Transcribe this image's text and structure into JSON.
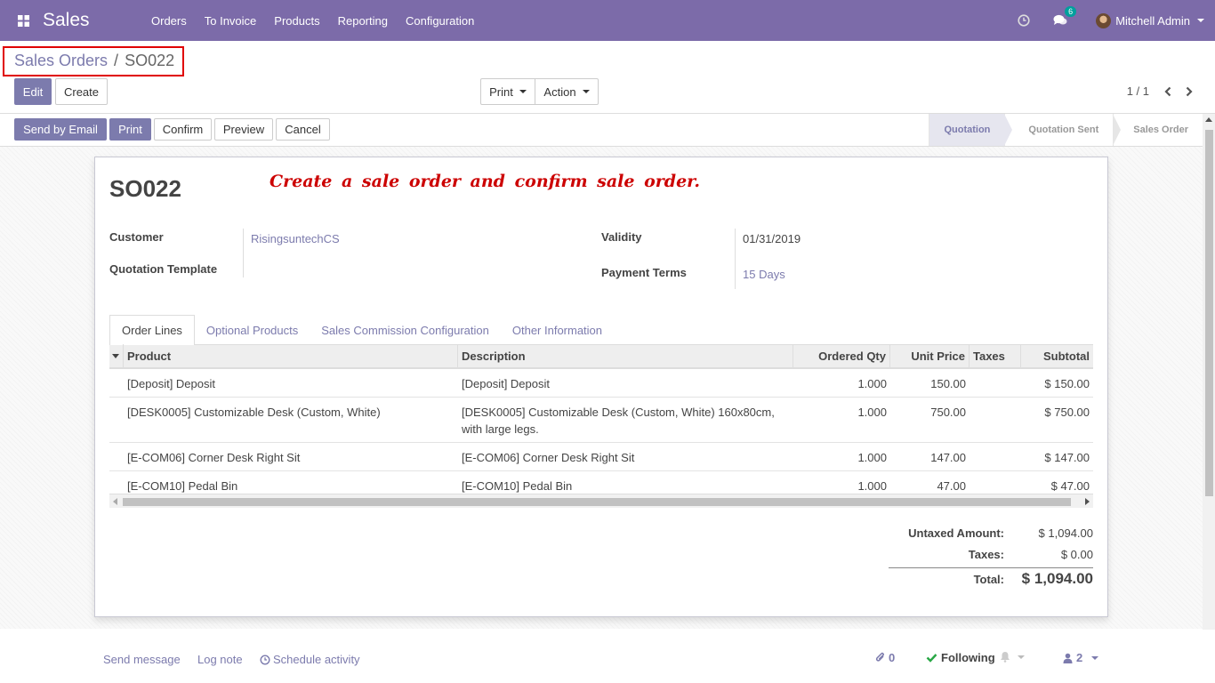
{
  "navbar": {
    "app_name": "Sales",
    "menu": [
      "Orders",
      "To Invoice",
      "Products",
      "Reporting",
      "Configuration"
    ],
    "messages_badge": "6",
    "user_name": "Mitchell Admin",
    "bg_color": "#7c6ba9"
  },
  "breadcrumb": {
    "parent": "Sales Orders",
    "sep": "/",
    "current": "SO022"
  },
  "control": {
    "edit": "Edit",
    "create": "Create",
    "print": "Print",
    "action": "Action",
    "pager": "1 / 1"
  },
  "buttons": {
    "send_email": "Send by Email",
    "print": "Print",
    "confirm": "Confirm",
    "preview": "Preview",
    "cancel": "Cancel"
  },
  "statusbar": {
    "stages": [
      "Quotation",
      "Quotation Sent",
      "Sales Order"
    ],
    "active": "Quotation"
  },
  "form": {
    "name": "SO022",
    "annotation": "Create a sale order and confirm sale order.",
    "customer_label": "Customer",
    "customer_value": "RisingsuntechCS",
    "template_label": "Quotation Template",
    "validity_label": "Validity",
    "validity_value": "01/31/2019",
    "payment_terms_label": "Payment Terms",
    "payment_terms_value": "15 Days"
  },
  "tabs": [
    "Order Lines",
    "Optional Products",
    "Sales Commission Configuration",
    "Other Information"
  ],
  "table": {
    "headers": [
      "Product",
      "Description",
      "Ordered Qty",
      "Unit Price",
      "Taxes",
      "Subtotal"
    ],
    "rows": [
      {
        "product": "[Deposit] Deposit",
        "description": "[Deposit] Deposit",
        "qty": "1.000",
        "price": "150.00",
        "taxes": "",
        "subtotal": "$ 150.00"
      },
      {
        "product": "[DESK0005] Customizable Desk (Custom, White)",
        "description": "[DESK0005] Customizable Desk (Custom, White) 160x80cm, with large legs.",
        "qty": "1.000",
        "price": "750.00",
        "taxes": "",
        "subtotal": "$ 750.00"
      },
      {
        "product": "[E-COM06] Corner Desk Right Sit",
        "description": "[E-COM06] Corner Desk Right Sit",
        "qty": "1.000",
        "price": "147.00",
        "taxes": "",
        "subtotal": "$ 147.00"
      },
      {
        "product": "[E-COM10] Pedal Bin",
        "description": "[E-COM10] Pedal Bin",
        "qty": "1.000",
        "price": "47.00",
        "taxes": "",
        "subtotal": "$ 47.00"
      }
    ]
  },
  "totals": {
    "untaxed_label": "Untaxed Amount:",
    "untaxed_value": "$ 1,094.00",
    "taxes_label": "Taxes:",
    "taxes_value": "$ 0.00",
    "total_label": "Total:",
    "total_value": "$ 1,094.00"
  },
  "chatter": {
    "send_message": "Send message",
    "log_note": "Log note",
    "schedule_activity": "Schedule activity",
    "attachments": "0",
    "following": "Following",
    "followers": "2"
  }
}
